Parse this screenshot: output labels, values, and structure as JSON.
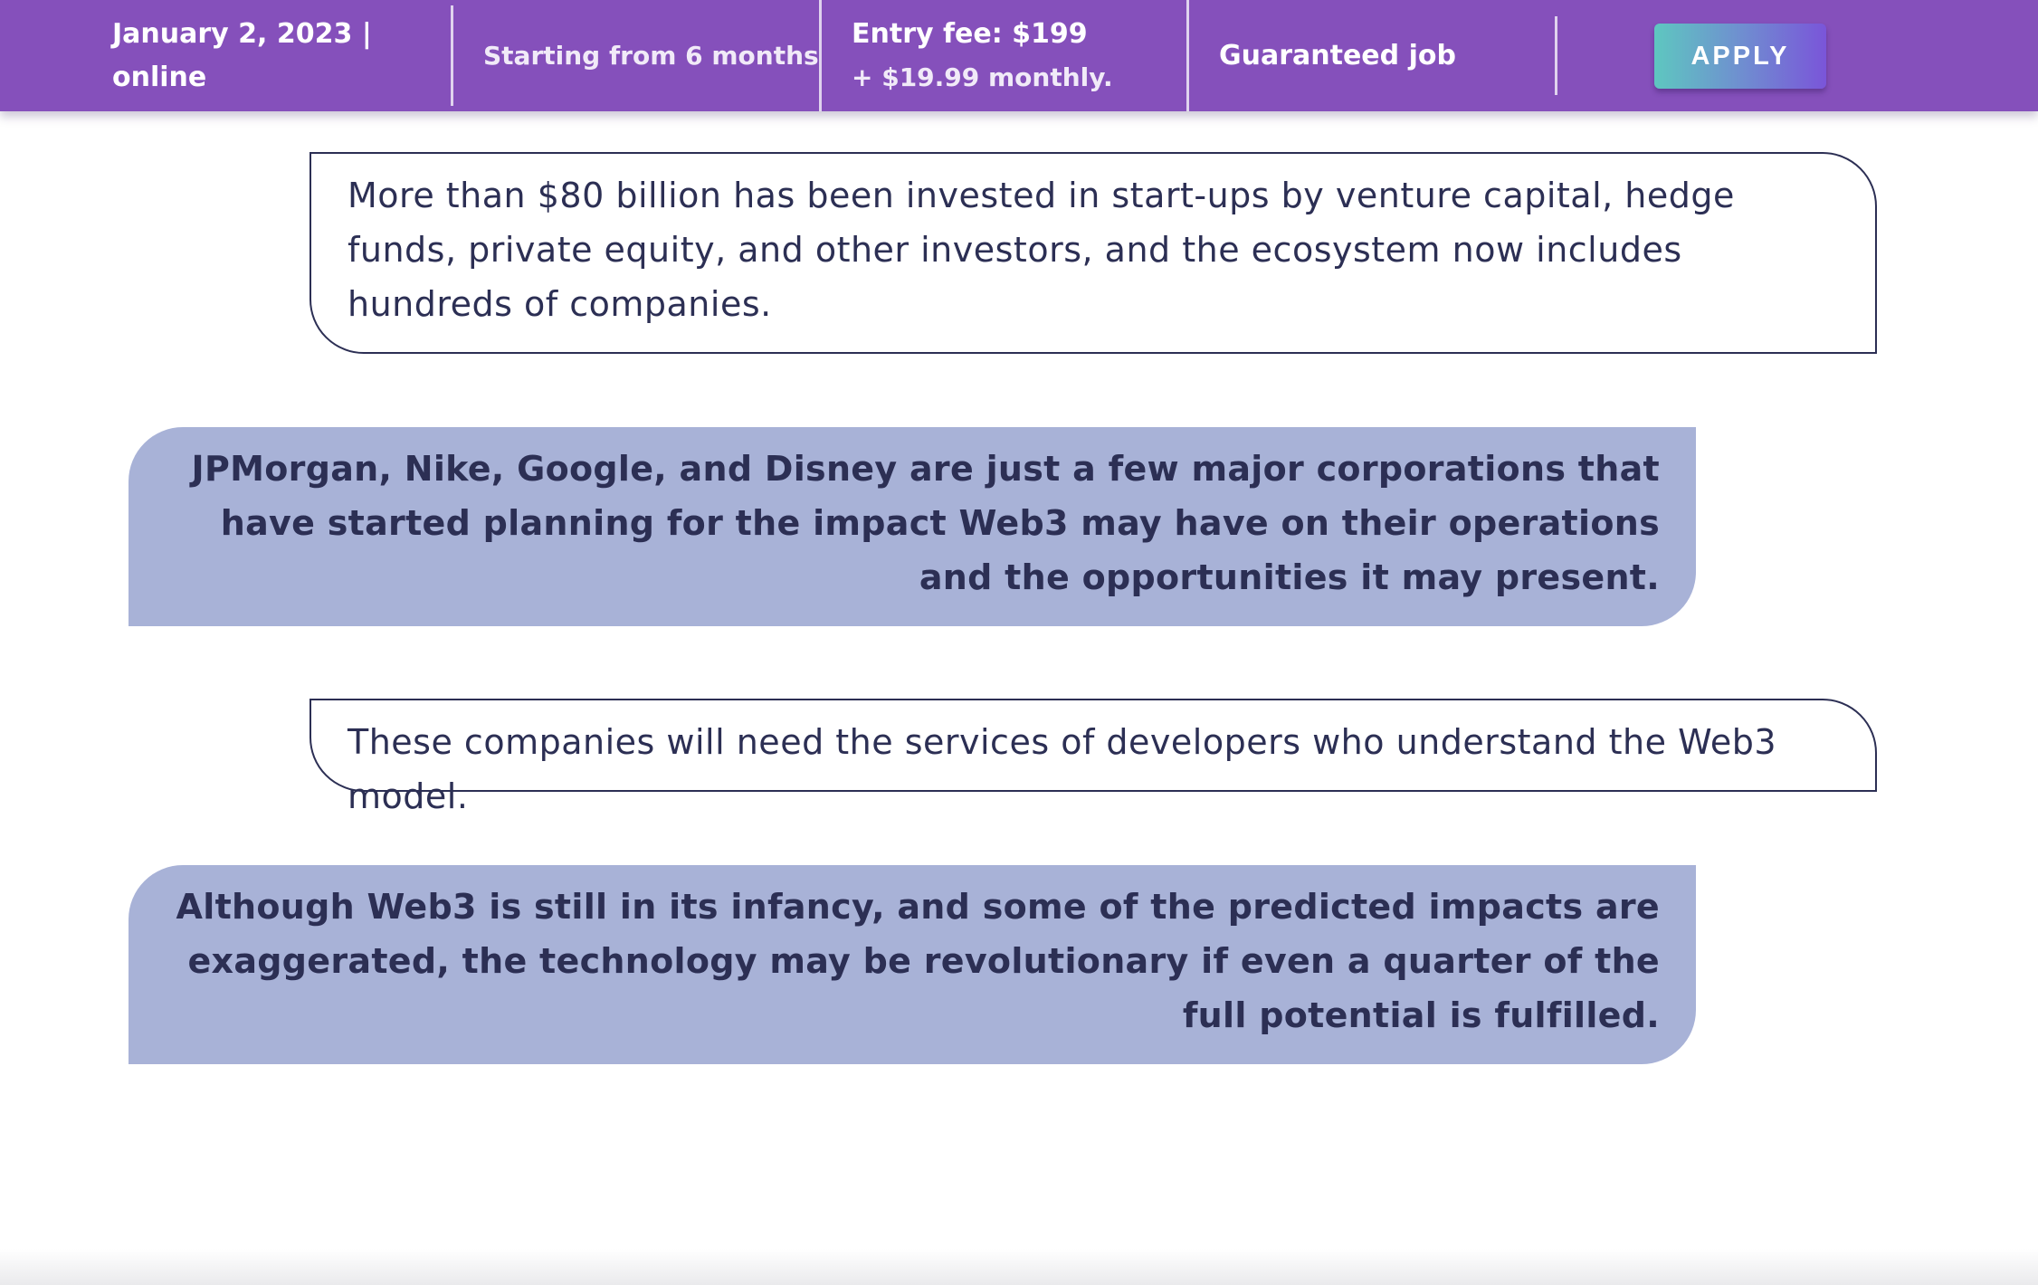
{
  "header": {
    "date_line1": "January 2, 2023 |",
    "date_line2": "online",
    "duration": "Starting from 6 months",
    "fee_line1": "Entry fee: $199",
    "fee_line2": "+ $19.99 monthly.",
    "guarantee": "Guaranteed job",
    "apply_label": "APPLY"
  },
  "content": {
    "blocks": [
      {
        "style": "outline",
        "text": "More than $80 billion has been invested in start-ups by venture capital, hedge funds, private equity, and other investors, and the ecosystem now includes hundreds of companies."
      },
      {
        "style": "filled",
        "text": "JPMorgan, Nike, Google, and Disney are just a few major corporations that have started planning for the impact Web3 may have on their operations and the opportunities it may present."
      },
      {
        "style": "outline",
        "text": "These companies will need the services of developers who understand the Web3 model."
      },
      {
        "style": "filled",
        "text": "Although Web3 is still in its infancy, and some of the predicted impacts are exaggerated, the technology may be revolutionary if even a quarter of the full potential is fulfilled."
      }
    ]
  },
  "colors": {
    "header_bg": "#8550bb",
    "text_dark": "#2c2f54",
    "filled_bubble": "#a8b2d7",
    "button_gradient_start": "#5ec7c0",
    "button_gradient_end": "#7a55d9"
  }
}
